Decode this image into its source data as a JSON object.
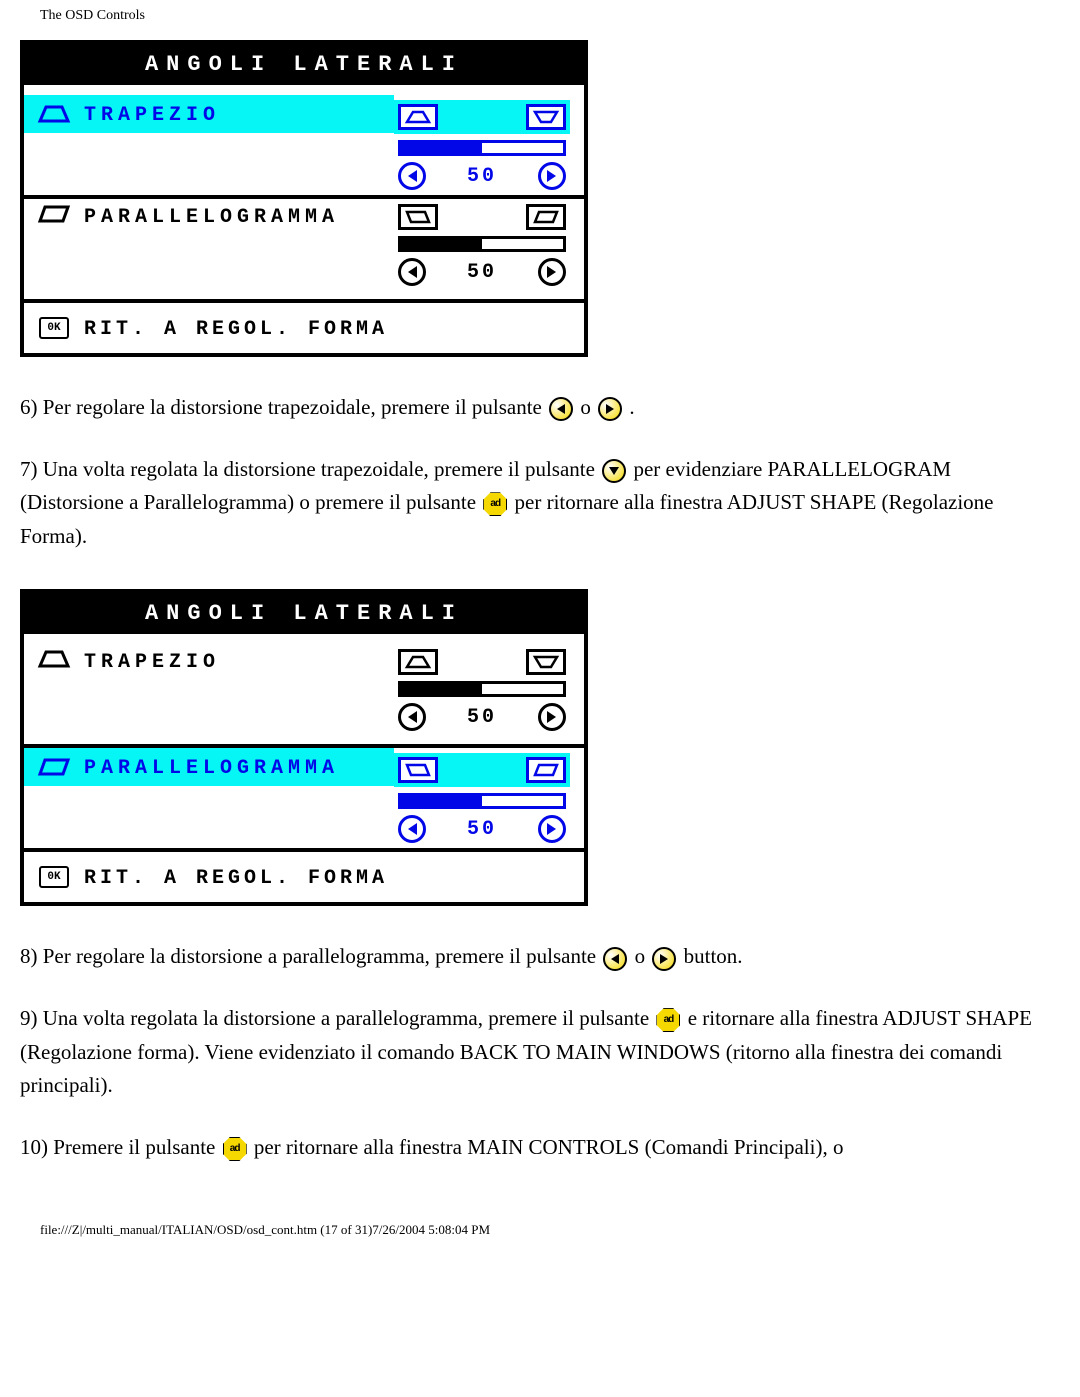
{
  "header": "The OSD Controls",
  "osd": {
    "title": "ANGOLI LATERALI",
    "row1_label": "TRAPEZIO",
    "row1_value": "50",
    "row2_label": "PARALLELOGRAMMA",
    "row2_value": "50",
    "footer_label": "RIT. A REGOL. FORMA"
  },
  "text": {
    "p6a": "6) Per regolare la distorsione trapezoidale, premere il pulsante ",
    "p6b": " o ",
    "p6c": " .",
    "p7a": "7) Una volta regolata la distorsione trapezoidale, premere il pulsante ",
    "p7b": "per evidenziare PARALLELOGRAM (Distorsione a Parallelogramma) o premere il pulsante ",
    "p7c": " per ritornare alla finestra ADJUST SHAPE (Regolazione Forma).",
    "p8a": "8) Per regolare la distorsione a parallelogramma, premere il pulsante ",
    "p8b": " o ",
    "p8c": " button.",
    "p9a": "9) Una volta regolata la distorsione a parallelogramma, premere il pulsante ",
    "p9b": "e ritornare alla finestra ADJUST SHAPE (Regolazione forma). Viene evidenziato il comando BACK TO MAIN WINDOWS (ritorno alla finestra dei comandi principali).",
    "p10a": "10) Premere il pulsante ",
    "p10b": "per ritornare alla finestra MAIN CONTROLS (Comandi Principali), o"
  },
  "footer": "file:///Z|/multi_manual/ITALIAN/OSD/osd_cont.htm (17 of 31)7/26/2004 5:08:04 PM"
}
